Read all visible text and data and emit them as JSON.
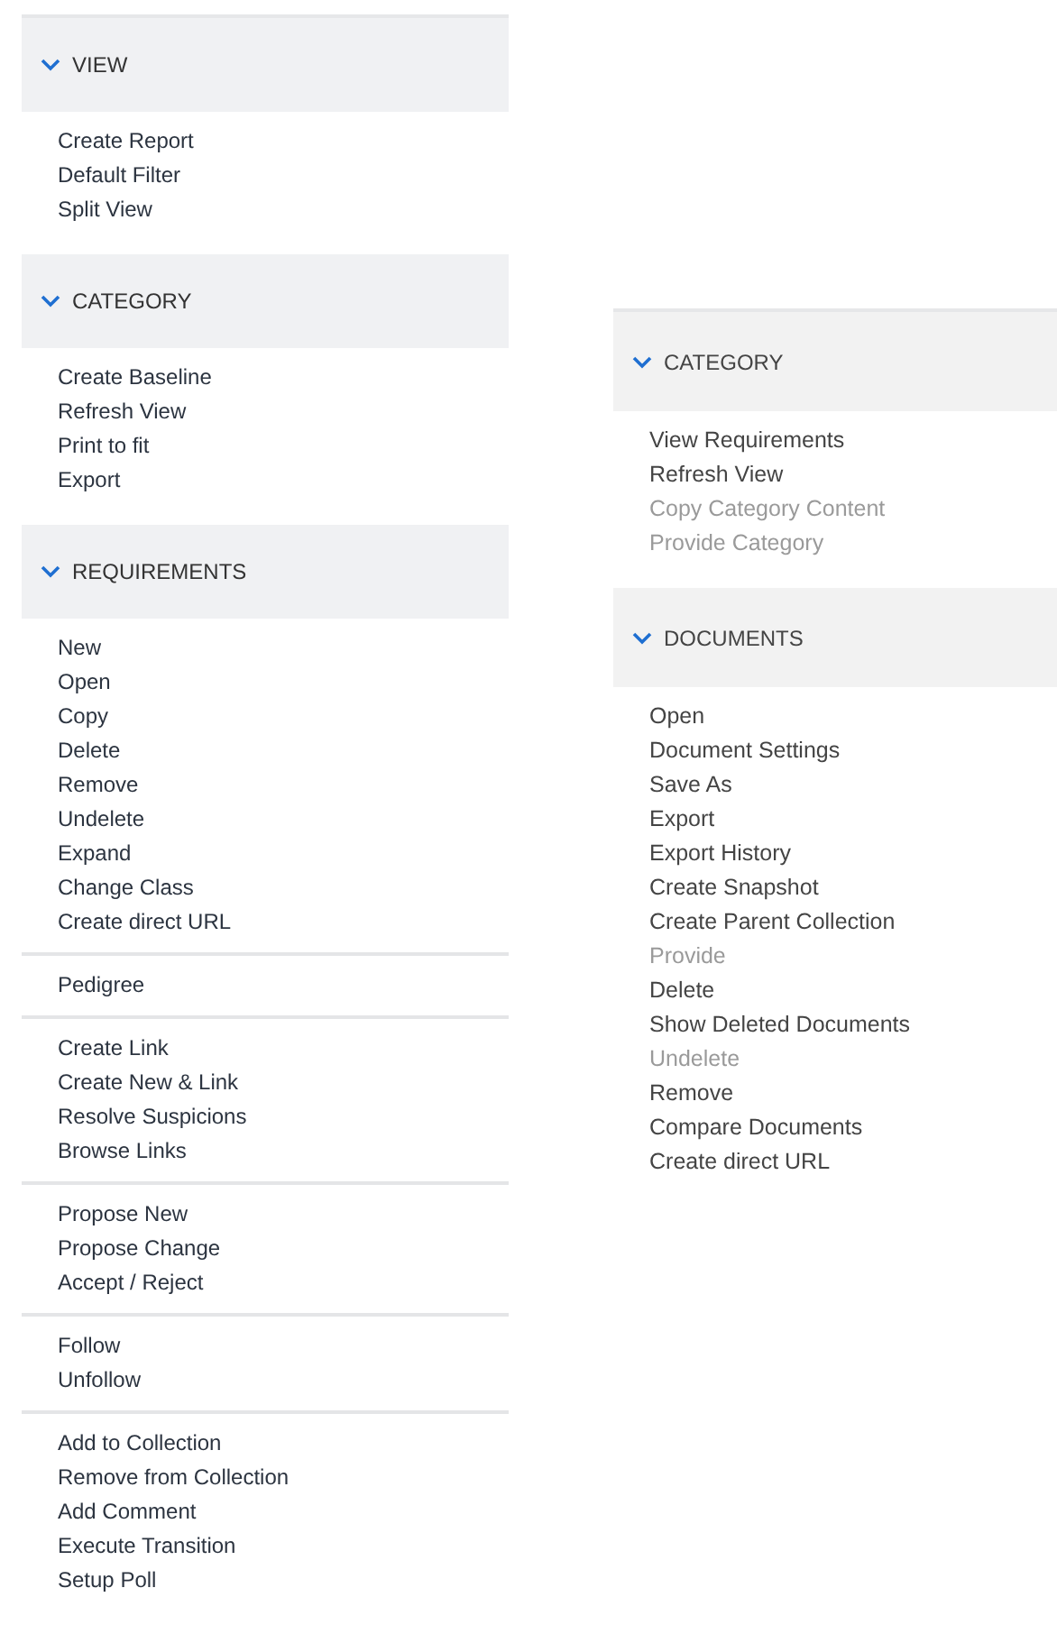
{
  "panels": [
    {
      "sections": [
        {
          "title": "VIEW",
          "expanded": true,
          "groups": [
            {
              "items": [
                {
                  "label": "Create Report",
                  "disabled": false
                },
                {
                  "label": "Default Filter",
                  "disabled": false
                },
                {
                  "label": "Split View",
                  "disabled": false
                }
              ]
            }
          ]
        },
        {
          "title": "CATEGORY",
          "expanded": true,
          "groups": [
            {
              "items": [
                {
                  "label": "Create Baseline",
                  "disabled": false
                },
                {
                  "label": "Refresh View",
                  "disabled": false
                },
                {
                  "label": "Print to fit",
                  "disabled": false
                },
                {
                  "label": "Export",
                  "disabled": false
                }
              ]
            }
          ]
        },
        {
          "title": "REQUIREMENTS",
          "expanded": true,
          "groups": [
            {
              "items": [
                {
                  "label": "New",
                  "disabled": false
                },
                {
                  "label": "Open",
                  "disabled": false
                },
                {
                  "label": "Copy",
                  "disabled": false
                },
                {
                  "label": "Delete",
                  "disabled": false
                },
                {
                  "label": "Remove",
                  "disabled": false
                },
                {
                  "label": "Undelete",
                  "disabled": false
                },
                {
                  "label": "Expand",
                  "disabled": false
                },
                {
                  "label": "Change Class",
                  "disabled": false
                },
                {
                  "label": "Create direct URL",
                  "disabled": false
                }
              ]
            },
            {
              "items": [
                {
                  "label": "Pedigree",
                  "disabled": false
                }
              ]
            },
            {
              "items": [
                {
                  "label": "Create Link",
                  "disabled": false
                },
                {
                  "label": "Create New & Link",
                  "disabled": false
                },
                {
                  "label": "Resolve Suspicions",
                  "disabled": false
                },
                {
                  "label": "Browse Links",
                  "disabled": false
                }
              ]
            },
            {
              "items": [
                {
                  "label": "Propose New",
                  "disabled": false
                },
                {
                  "label": "Propose Change",
                  "disabled": false
                },
                {
                  "label": "Accept / Reject",
                  "disabled": false
                }
              ]
            },
            {
              "items": [
                {
                  "label": "Follow",
                  "disabled": false
                },
                {
                  "label": "Unfollow",
                  "disabled": false
                }
              ]
            },
            {
              "items": [
                {
                  "label": "Add to Collection",
                  "disabled": false
                },
                {
                  "label": "Remove from Collection",
                  "disabled": false
                },
                {
                  "label": "Add Comment",
                  "disabled": false
                },
                {
                  "label": "Execute Transition",
                  "disabled": false
                },
                {
                  "label": "Setup Poll",
                  "disabled": false
                }
              ]
            }
          ]
        }
      ]
    },
    {
      "sections": [
        {
          "title": "CATEGORY",
          "expanded": true,
          "groups": [
            {
              "items": [
                {
                  "label": "View Requirements",
                  "disabled": false
                },
                {
                  "label": "Refresh View",
                  "disabled": false
                },
                {
                  "label": "Copy Category Content",
                  "disabled": true
                },
                {
                  "label": "Provide Category",
                  "disabled": true
                }
              ]
            }
          ]
        },
        {
          "title": "DOCUMENTS",
          "expanded": true,
          "groups": [
            {
              "items": [
                {
                  "label": "Open",
                  "disabled": false
                },
                {
                  "label": "Document Settings",
                  "disabled": false
                },
                {
                  "label": "Save As",
                  "disabled": false
                },
                {
                  "label": "Export",
                  "disabled": false
                },
                {
                  "label": "Export History",
                  "disabled": false
                },
                {
                  "label": "Create Snapshot",
                  "disabled": false
                },
                {
                  "label": "Create Parent Collection",
                  "disabled": false
                },
                {
                  "label": "Provide",
                  "disabled": true
                },
                {
                  "label": "Delete",
                  "disabled": false
                },
                {
                  "label": "Show Deleted Documents",
                  "disabled": false
                },
                {
                  "label": "Undelete",
                  "disabled": true
                },
                {
                  "label": "Remove",
                  "disabled": false
                },
                {
                  "label": "Compare Documents",
                  "disabled": false
                },
                {
                  "label": "Create direct URL",
                  "disabled": false
                }
              ]
            }
          ]
        }
      ]
    }
  ]
}
